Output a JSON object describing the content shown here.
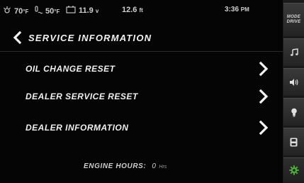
{
  "status": {
    "outside_temp": "70",
    "outside_unit": "°F",
    "water_temp": "50",
    "water_unit": "°F",
    "battery": "11.9",
    "battery_unit": "v",
    "depth": "12.6",
    "depth_unit": "ft",
    "time": "3:36",
    "time_suffix": "PM"
  },
  "header": {
    "title": "SERVICE INFORMATION"
  },
  "menu": {
    "items": [
      {
        "label": "OIL CHANGE RESET"
      },
      {
        "label": "DEALER SERVICE RESET"
      },
      {
        "label": "DEALER INFORMATION"
      }
    ]
  },
  "engine_hours": {
    "label": "ENGINE HOURS:",
    "value": "0",
    "unit": "Hrs"
  },
  "sidebar": {
    "mode_line1": "MODE",
    "mode_line2": "DRIVE",
    "icons": [
      "music-note-icon",
      "speaker-icon",
      "light-bulb-icon",
      "save-icon",
      "gear-icon"
    ],
    "active_color": "#4ca83a"
  }
}
